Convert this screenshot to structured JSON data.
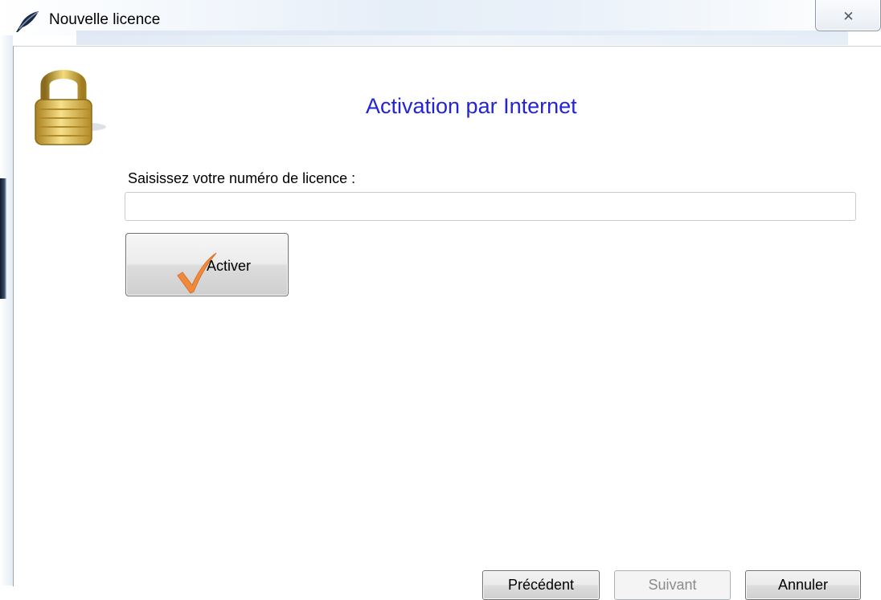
{
  "window": {
    "title": "Nouvelle licence",
    "close_glyph": "✕",
    "app_icon": "pen-icon"
  },
  "page": {
    "heading": "Activation par Internet",
    "icon": "padlock-icon",
    "license_label": "Saisissez votre numéro de licence :",
    "license_value": "",
    "activate_label": "Activer",
    "activate_icon": "checkmark-icon"
  },
  "footer": {
    "previous_label": "Précédent",
    "next_label": "Suivant",
    "next_enabled": false,
    "cancel_label": "Annuler"
  },
  "colors": {
    "heading": "#2323d8",
    "checkmark": "#f08a3a"
  }
}
